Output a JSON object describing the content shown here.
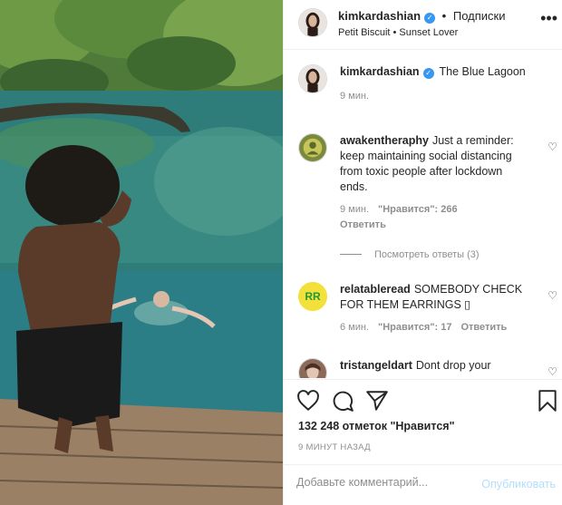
{
  "header": {
    "username": "kimkardashian",
    "separator": "•",
    "follow_label": "Подписки",
    "song": "Petit Biscuit • Sunset Lover",
    "more_glyph": "•••"
  },
  "caption": {
    "username": "kimkardashian",
    "text": "The Blue Lagoon",
    "time": "9 мин."
  },
  "comments": [
    {
      "username": "awakentheraphy",
      "text": "Just a reminder: keep maintaining social distancing from toxic people after lockdown ends.",
      "time": "9 мин.",
      "likes": "\"Нравится\": 266",
      "reply": "Ответить",
      "view_replies": "Посмотреть ответы (3)"
    },
    {
      "username": "relatableread",
      "text": "SOMEBODY CHECK FOR THEM EARRINGS ▯",
      "time": "6 мин.",
      "likes": "\"Нравится\": 17",
      "reply": "Ответить",
      "avatar_text": "RR"
    },
    {
      "username": "tristangeldart",
      "text": "Dont drop your"
    }
  ],
  "actions": {
    "like_icon": "heart-icon",
    "comment_icon": "comment-icon",
    "share_icon": "share-icon",
    "save_icon": "bookmark-icon",
    "likes_text": "132 248 отметок \"Нравится\"",
    "time_ago": "9 МИНУТ НАЗАД"
  },
  "add_comment": {
    "placeholder": "Добавьте комментарий...",
    "publish_label": "Опубликовать"
  },
  "colors": {
    "verified": "#3897f0",
    "muted": "#8e8e8e",
    "publish_disabled": "#b2dffc",
    "rr_avatar": "#f3e03a"
  }
}
